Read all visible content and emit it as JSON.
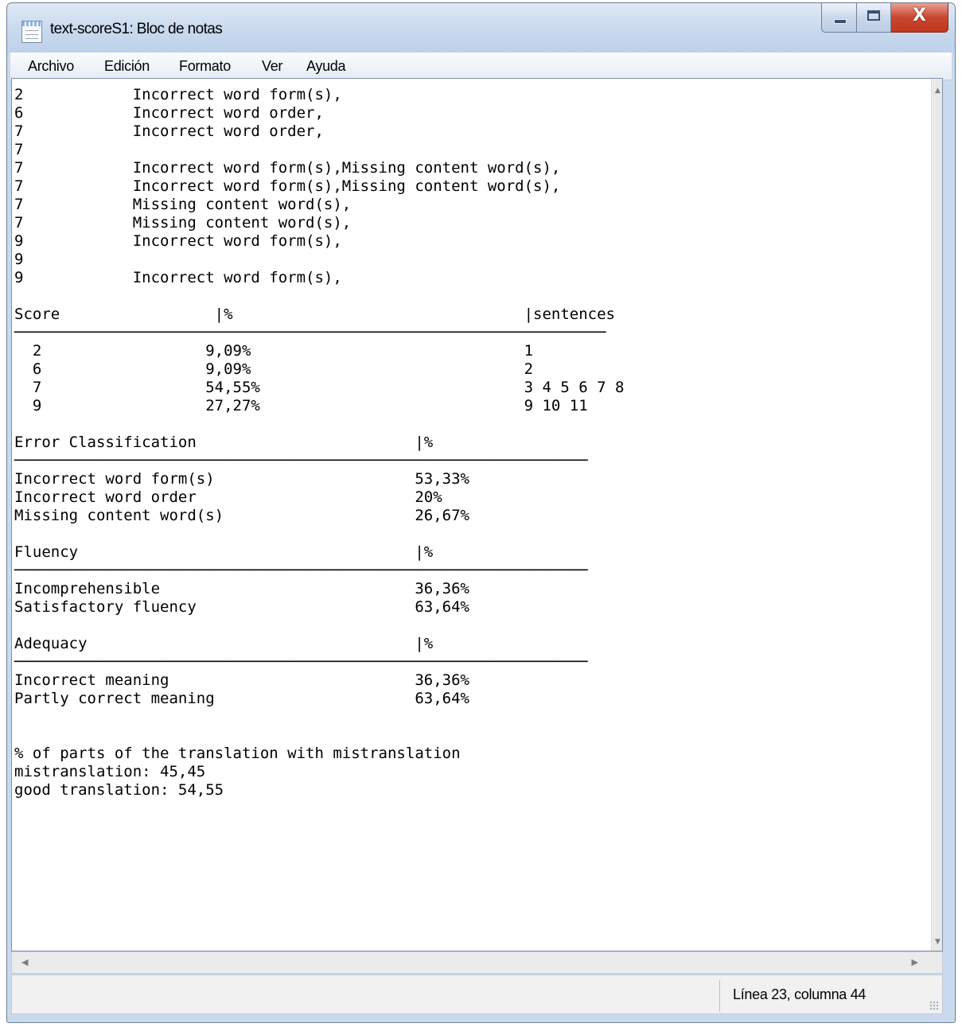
{
  "window": {
    "title": "text-scoreS1: Bloc de notas",
    "close_glyph": "X"
  },
  "menu": [
    "Archivo",
    "Edición",
    "Formato",
    "Ver",
    "Ayuda"
  ],
  "document": {
    "lines": [
      "2            Incorrect word form(s),",
      "6            Incorrect word order,",
      "7            Incorrect word order,",
      "7",
      "7            Incorrect word form(s),Missing content word(s),",
      "7            Incorrect word form(s),Missing content word(s),",
      "7            Missing content word(s),",
      "7            Missing content word(s),",
      "9            Incorrect word form(s),",
      "9",
      "9            Incorrect word form(s),",
      "",
      "Score                 |%                                |sentences",
      "─────────────────────────────────────────────────────────────────",
      "  2                  9,09%                              1",
      "  6                  9,09%                              2",
      "  7                  54,55%                             3 4 5 6 7 8",
      "  9                  27,27%                             9 10 11",
      "",
      "Error Classification                        |%",
      "───────────────────────────────────────────────────────────────",
      "Incorrect word form(s)                      53,33%",
      "Incorrect word order                        20%",
      "Missing content word(s)                     26,67%",
      "",
      "Fluency                                     |%",
      "───────────────────────────────────────────────────────────────",
      "Incomprehensible                            36,36%",
      "Satisfactory fluency                        63,64%",
      "",
      "Adequacy                                    |%",
      "───────────────────────────────────────────────────────────────",
      "Incorrect meaning                           36,36%",
      "Partly correct meaning                      63,64%",
      "",
      "",
      "% of parts of the translation with mistranslation",
      "mistranslation: 45,45",
      "good translation: 54,55"
    ]
  },
  "statusbar": {
    "position": "Línea 23, columna 44"
  },
  "icons": [
    "notepad-app-icon",
    "minimize-icon",
    "maximize-icon",
    "close-icon",
    "scroll-up-arrow-icon",
    "scroll-down-arrow-icon",
    "scroll-left-arrow-icon",
    "scroll-right-arrow-icon",
    "resize-grip-icon"
  ]
}
